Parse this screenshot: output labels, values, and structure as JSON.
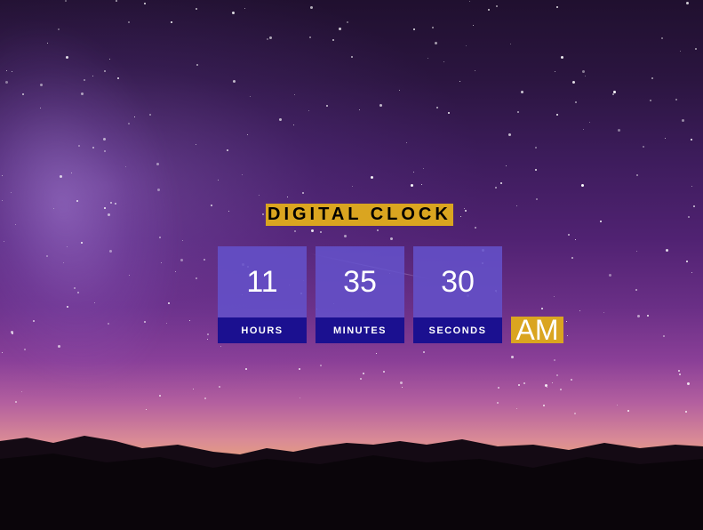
{
  "clock": {
    "title": "DIGITAL CLOCK",
    "hours": "11",
    "minutes": "35",
    "seconds": "30",
    "hours_label": "HOURS",
    "minutes_label": "MINUTES",
    "seconds_label": "SECONDS",
    "period": "AM"
  },
  "colors": {
    "accent": "#daa520",
    "box": "#6450c8",
    "label_bar": "#1b1090"
  }
}
